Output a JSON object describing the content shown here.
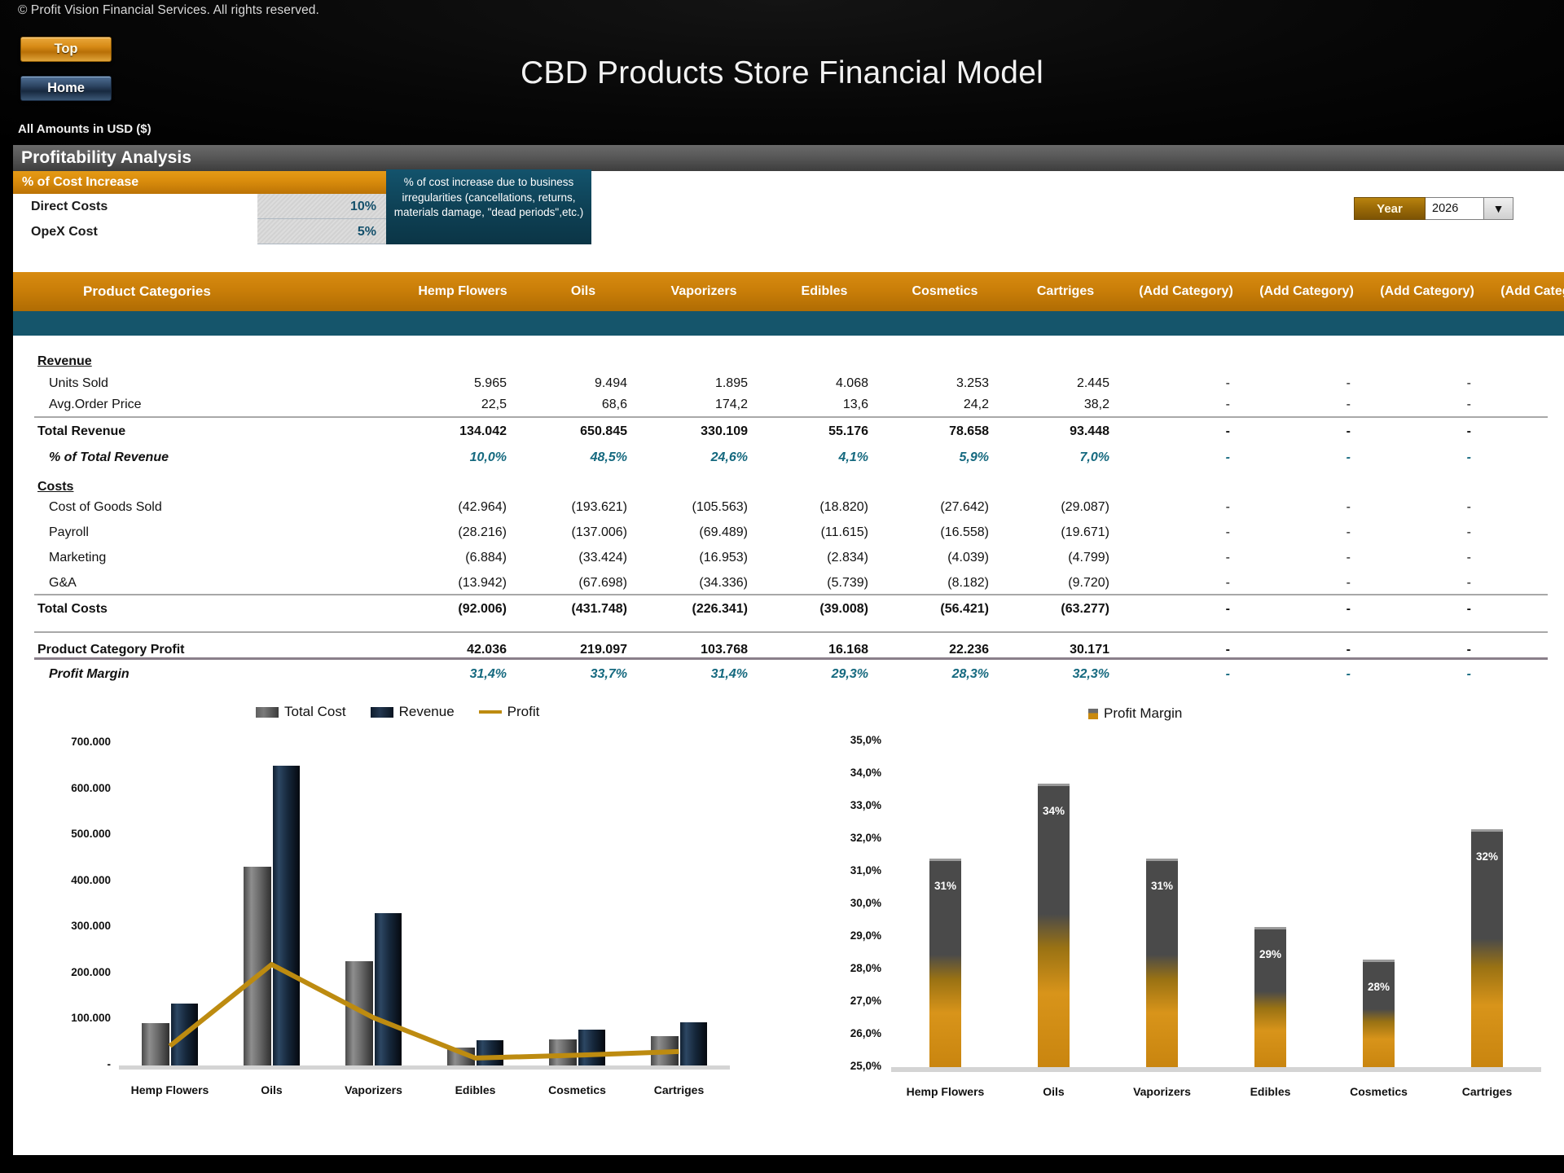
{
  "header": {
    "copyright": "© Profit Vision Financial Services. All rights reserved.",
    "nav_top": "Top",
    "nav_home": "Home",
    "title": "CBD Products Store Financial Model",
    "amounts_note": "All Amounts in  USD ($)"
  },
  "section": {
    "title": "Profitability Analysis"
  },
  "cost_increase": {
    "header": "% of Cost Increase",
    "rows": [
      {
        "label": "Direct Costs",
        "value": "10%"
      },
      {
        "label": "OpeX Cost",
        "value": "5%"
      }
    ],
    "tooltip": "% of cost increase due to business irregularities (cancellations, returns, materials damage, \"dead periods\",etc.)"
  },
  "year_selector": {
    "label": "Year",
    "value": "2026",
    "arrow": "chevron-down-icon"
  },
  "table": {
    "header": [
      "Product Categories",
      "Hemp Flowers",
      "Oils",
      "Vaporizers",
      "Edibles",
      "Cosmetics",
      "Cartriges",
      "(Add Category)",
      "(Add Category)",
      "(Add Category)",
      "(Add Category)"
    ],
    "revenue_title": "Revenue",
    "costs_title": "Costs",
    "rows": {
      "units_sold": {
        "label": "Units Sold",
        "values": [
          "5.965",
          "9.494",
          "1.895",
          "4.068",
          "3.253",
          "2.445",
          "-",
          "-",
          "-",
          "-"
        ]
      },
      "avg_price": {
        "label": "Avg.Order Price",
        "values": [
          "22,5",
          "68,6",
          "174,2",
          "13,6",
          "24,2",
          "38,2",
          "-",
          "-",
          "-",
          "-"
        ]
      },
      "total_revenue": {
        "label": "Total Revenue",
        "values": [
          "134.042",
          "650.845",
          "330.109",
          "55.176",
          "78.658",
          "93.448",
          "-",
          "-",
          "-",
          "-"
        ]
      },
      "pct_revenue": {
        "label": "% of Total Revenue",
        "values": [
          "10,0%",
          "48,5%",
          "24,6%",
          "4,1%",
          "5,9%",
          "7,0%",
          "-",
          "-",
          "-",
          "-"
        ]
      },
      "cogs": {
        "label": "Cost of Goods Sold",
        "values": [
          "(42.964)",
          "(193.621)",
          "(105.563)",
          "(18.820)",
          "(27.642)",
          "(29.087)",
          "-",
          "-",
          "-",
          "-"
        ]
      },
      "payroll": {
        "label": "Payroll",
        "values": [
          "(28.216)",
          "(137.006)",
          "(69.489)",
          "(11.615)",
          "(16.558)",
          "(19.671)",
          "-",
          "-",
          "-",
          "-"
        ]
      },
      "marketing": {
        "label": "Marketing",
        "values": [
          "(6.884)",
          "(33.424)",
          "(16.953)",
          "(2.834)",
          "(4.039)",
          "(4.799)",
          "-",
          "-",
          "-",
          "-"
        ]
      },
      "gna": {
        "label": "G&A",
        "values": [
          "(13.942)",
          "(67.698)",
          "(34.336)",
          "(5.739)",
          "(8.182)",
          "(9.720)",
          "-",
          "-",
          "-",
          "-"
        ]
      },
      "total_costs": {
        "label": "Total Costs",
        "values": [
          "(92.006)",
          "(431.748)",
          "(226.341)",
          "(39.008)",
          "(56.421)",
          "(63.277)",
          "-",
          "-",
          "-",
          "-"
        ]
      },
      "profit": {
        "label": "Product Category Profit",
        "values": [
          "42.036",
          "219.097",
          "103.768",
          "16.168",
          "22.236",
          "30.171",
          "-",
          "-",
          "-",
          "-"
        ]
      },
      "margin": {
        "label": "Profit Margin",
        "values": [
          "31,4%",
          "33,7%",
          "31,4%",
          "29,3%",
          "28,3%",
          "32,3%",
          "-",
          "-",
          "-",
          "-"
        ]
      }
    }
  },
  "chart_data": [
    {
      "type": "bar",
      "title": "",
      "categories": [
        "Hemp Flowers",
        "Oils",
        "Vaporizers",
        "Edibles",
        "Cosmetics",
        "Cartriges"
      ],
      "series": [
        {
          "name": "Total Cost",
          "type": "bar",
          "values": [
            92006,
            431748,
            226341,
            39008,
            56421,
            63277
          ]
        },
        {
          "name": "Revenue",
          "type": "bar",
          "values": [
            134042,
            650845,
            330109,
            55176,
            78658,
            93448
          ]
        },
        {
          "name": "Profit",
          "type": "line",
          "values": [
            42036,
            219097,
            103768,
            16168,
            22236,
            30171
          ]
        }
      ],
      "yticks": [
        "-",
        "100.000",
        "200.000",
        "300.000",
        "400.000",
        "500.000",
        "600.000",
        "700.000"
      ],
      "ylim": [
        0,
        700000
      ],
      "xlabel": "",
      "ylabel": "",
      "grid": false,
      "legend_position": "top"
    },
    {
      "type": "bar",
      "title": "",
      "categories": [
        "Hemp Flowers",
        "Oils",
        "Vaporizers",
        "Edibles",
        "Cosmetics",
        "Cartriges"
      ],
      "series": [
        {
          "name": "Profit Margin",
          "type": "bar",
          "values": [
            31.4,
            33.7,
            31.4,
            29.3,
            28.3,
            32.3
          ]
        }
      ],
      "data_labels": [
        "31%",
        "34%",
        "31%",
        "29%",
        "28%",
        "32%"
      ],
      "yticks": [
        "25,0%",
        "26,0%",
        "27,0%",
        "28,0%",
        "29,0%",
        "30,0%",
        "31,0%",
        "32,0%",
        "33,0%",
        "34,0%",
        "35,0%"
      ],
      "ylim": [
        25,
        35
      ],
      "xlabel": "",
      "ylabel": "",
      "grid": false,
      "legend_position": "top"
    }
  ],
  "colors": {
    "accent_orange": "#c87d08",
    "teal": "#15556b",
    "pct_text": "#15697f",
    "profit_line": "#bd8b10",
    "revenue_bar": "#16283c",
    "cost_bar": "#6d6d6d"
  }
}
